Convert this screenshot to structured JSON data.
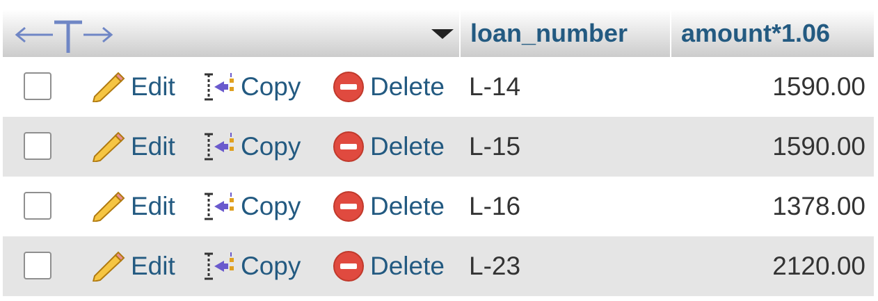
{
  "header": {
    "columns": [
      {
        "label": "loan_number"
      },
      {
        "label": "amount*1.06"
      }
    ],
    "toggle_icon": "column-arrows-icon",
    "sort_icon": "dropdown-triangle-icon"
  },
  "actions": {
    "edit_label": "Edit",
    "copy_label": "Copy",
    "delete_label": "Delete"
  },
  "rows": [
    {
      "loan_number": "L-14",
      "amount": "1590.00"
    },
    {
      "loan_number": "L-15",
      "amount": "1590.00"
    },
    {
      "loan_number": "L-16",
      "amount": "1378.00"
    },
    {
      "loan_number": "L-23",
      "amount": "2120.00"
    }
  ],
  "colors": {
    "link": "#235a81",
    "text": "#333333",
    "row_alt": "#e5e5e5",
    "delete_red": "#e04a3f",
    "copy_purple": "#6a5acd"
  }
}
